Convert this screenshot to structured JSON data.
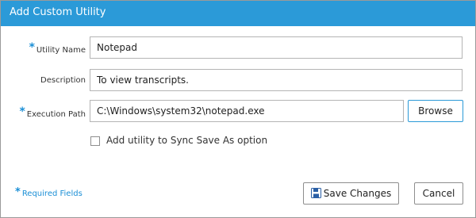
{
  "dialog": {
    "title": "Add Custom Utility",
    "fields": {
      "utility_name": {
        "label": "Utility Name",
        "value": "Notepad",
        "required": true
      },
      "description": {
        "label": "Description",
        "value": "To view transcripts.",
        "required": false
      },
      "execution_path": {
        "label": "Execution Path",
        "value": "C:\\Windows\\system32\\notepad.exe",
        "required": true
      }
    },
    "browse_label": "Browse",
    "sync_checkbox": {
      "label": "Add utility to Sync Save As option",
      "checked": false
    },
    "required_note": "Required Fields",
    "required_marker": "*",
    "save_label": "Save Changes",
    "cancel_label": "Cancel"
  },
  "colors": {
    "titlebar": "#2b9ad8",
    "accent": "#1b8fd6"
  },
  "icons": {
    "save": "floppy-disk-icon"
  }
}
